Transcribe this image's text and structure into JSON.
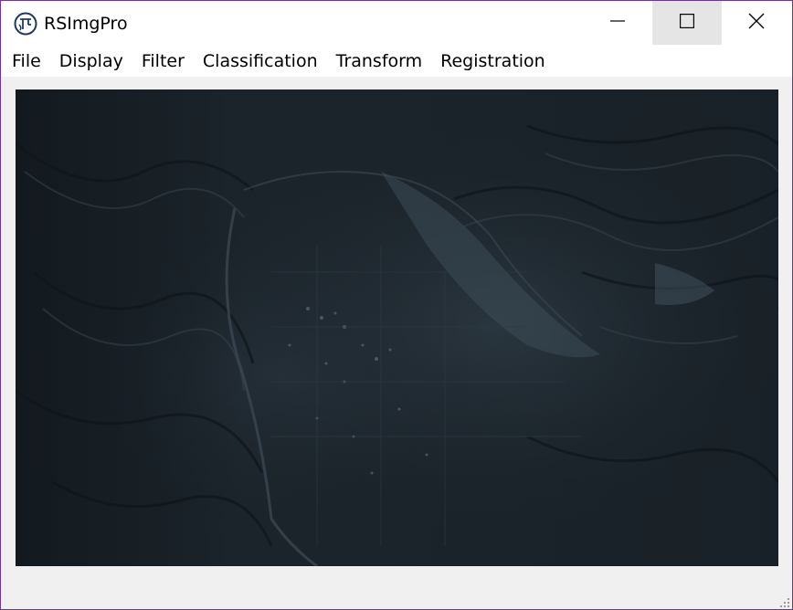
{
  "window": {
    "title": "RSImgPro",
    "border_color": "#6b3a8a"
  },
  "titlebar": {
    "app_icon": "app-logo-icon",
    "minimize_icon": "minimize-icon",
    "maximize_icon": "maximize-icon",
    "close_icon": "close-icon"
  },
  "menu": {
    "items": [
      {
        "label": "File"
      },
      {
        "label": "Display"
      },
      {
        "label": "Filter"
      },
      {
        "label": "Classification"
      },
      {
        "label": "Transform"
      },
      {
        "label": "Registration"
      }
    ]
  },
  "image_view": {
    "content": "satellite-image",
    "base_color": "#1b232a"
  }
}
